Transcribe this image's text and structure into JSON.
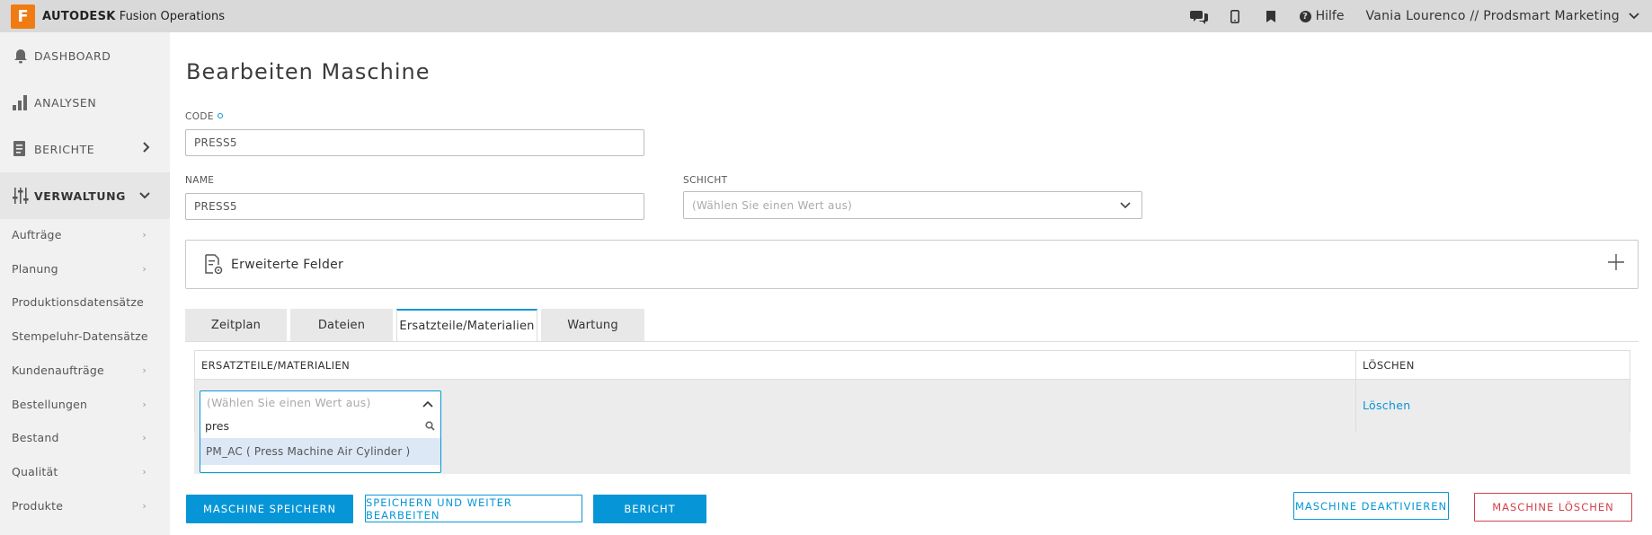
{
  "topbar": {
    "logo_letter": "F",
    "brand_bold": "AUTODESK",
    "brand_rest": "Fusion Operations",
    "help_label": "Hilfe",
    "user_label": "Vania Lourenco // Prodsmart Marketing",
    "icons": [
      "chat-icon",
      "mobile-icon",
      "bookmark-icon",
      "help-icon",
      "chevron-down-icon"
    ]
  },
  "sidebar": {
    "main_items": [
      {
        "label": "DASHBOARD",
        "icon": "bell-icon"
      },
      {
        "label": "ANALYSEN",
        "icon": "bar-chart-icon"
      },
      {
        "label": "BERICHTE",
        "icon": "report-icon"
      },
      {
        "label": "VERWALTUNG",
        "icon": "sliders-icon"
      }
    ],
    "sub_items": [
      {
        "label": "Aufträge",
        "chevron": true
      },
      {
        "label": "Planung",
        "chevron": true
      },
      {
        "label": "Produktionsdatensätze",
        "chevron": false
      },
      {
        "label": "Stempeluhr-Datensätze",
        "chevron": false
      },
      {
        "label": "Kundenaufträge",
        "chevron": true
      },
      {
        "label": "Bestellungen",
        "chevron": true
      },
      {
        "label": "Bestand",
        "chevron": true
      },
      {
        "label": "Qualität",
        "chevron": true
      },
      {
        "label": "Produkte",
        "chevron": true
      }
    ]
  },
  "page": {
    "title": "Bearbeiten Maschine",
    "code_label": "CODE",
    "code_value": "PRESS5",
    "name_label": "NAME",
    "name_value": "PRESS5",
    "shift_label": "SCHICHT",
    "shift_placeholder": "(Wählen Sie einen Wert aus)",
    "extended_fields_label": "Erweiterte Felder"
  },
  "tabs": [
    {
      "label": "Zeitplan",
      "active": false
    },
    {
      "label": "Dateien",
      "active": false
    },
    {
      "label": "Ersatzteile/Materialien",
      "active": true
    },
    {
      "label": "Wartung",
      "active": false
    }
  ],
  "table": {
    "col_material": "ERSATZTEILE/MATERIALIEN",
    "col_delete": "LÖSCHEN",
    "row_delete_link": "Löschen"
  },
  "dropdown": {
    "placeholder": "(Wählen Sie einen Wert aus)",
    "search_value": "pres",
    "option": "PM_AC ( Press Machine Air Cylinder )"
  },
  "buttons": {
    "save": "MASCHINE SPEICHERN",
    "save_continue": "SPEICHERN UND WEITER BEARBEITEN",
    "report": "BERICHT",
    "deactivate": "MASCHINE DEAKTIVIEREN",
    "delete": "MASCHINE LÖSCHEN"
  },
  "colors": {
    "accent": "#0696d7",
    "danger": "#d0424b",
    "logo": "#f07b13",
    "topbar": "#d9d9d9",
    "sidebar": "#f1f1f1"
  }
}
